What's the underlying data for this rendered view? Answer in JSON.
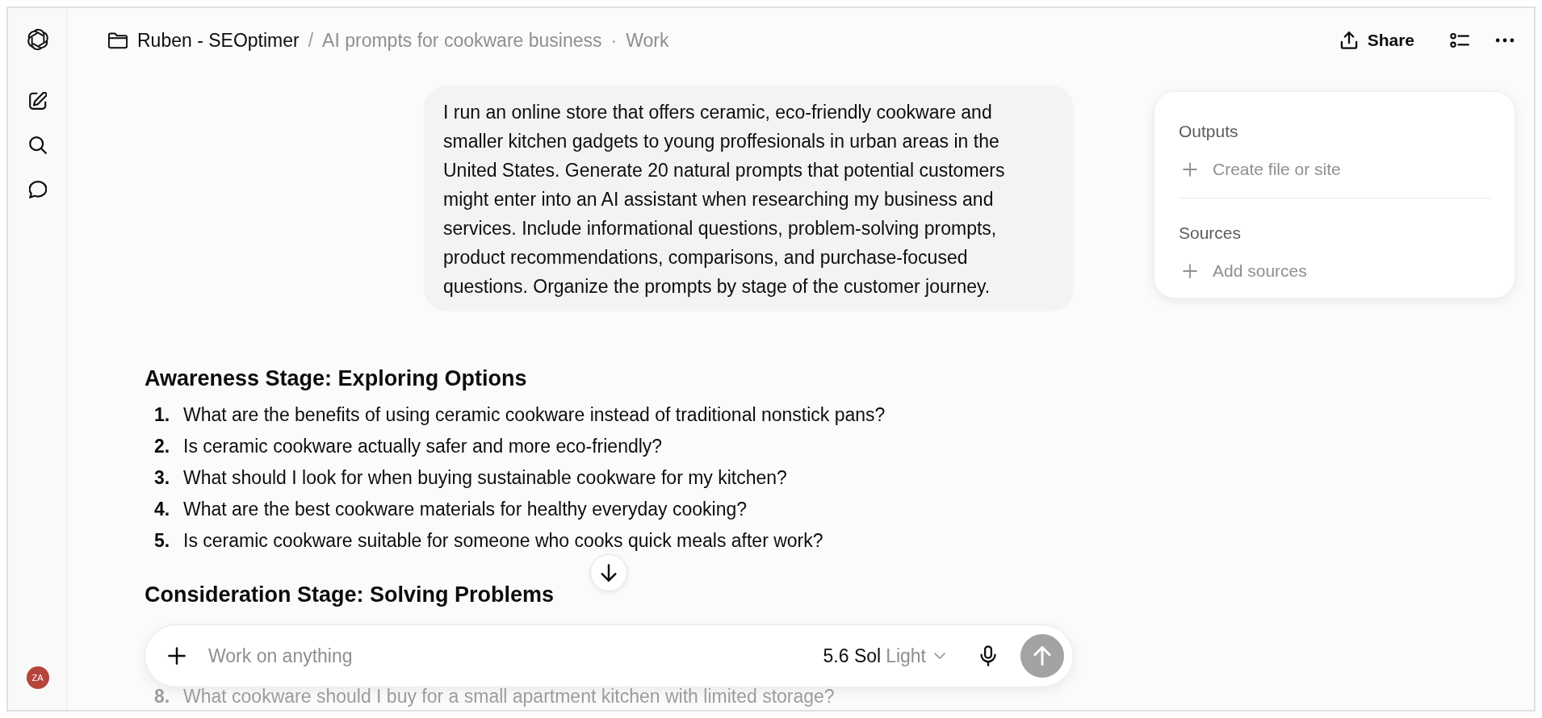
{
  "sidebar": {
    "avatar": {
      "initials": "ZA"
    }
  },
  "breadcrumb": {
    "project": "Ruben - SEOptimer",
    "separator": "/",
    "title": "AI prompts for cookware business",
    "dot": "·",
    "section": "Work"
  },
  "header": {
    "share": "Share"
  },
  "user_message": "I run an online store that offers ceramic, eco-friendly cookware and smaller kitchen gadgets to young proffesionals in urban areas in the United States. Generate 20 natural prompts that potential customers might enter into an AI assistant when researching my business and services. Include informational questions, problem-solving prompts, product recommendations, comparisons, and purchase-focused questions. Organize the prompts by stage of the customer journey.",
  "response": {
    "sections": [
      {
        "heading": "Awareness Stage: Exploring Options",
        "items": [
          {
            "number": "1.",
            "text": "What are the benefits of using ceramic cookware instead of traditional nonstick pans?",
            "faded": false
          },
          {
            "number": "2.",
            "text": "Is ceramic cookware actually safer and more eco-friendly?",
            "faded": false
          },
          {
            "number": "3.",
            "text": "What should I look for when buying sustainable cookware for my kitchen?",
            "faded": false
          },
          {
            "number": "4.",
            "text": "What are the best cookware materials for healthy everyday cooking?",
            "faded": false
          },
          {
            "number": "5.",
            "text": "Is ceramic cookware suitable for someone who cooks quick meals after work?",
            "faded": false
          }
        ]
      },
      {
        "heading": "Consideration Stage: Solving Problems",
        "items": [
          {
            "number": "8.",
            "text": "What cookware should I buy for a small apartment kitchen with limited storage?",
            "faded": true
          }
        ]
      }
    ]
  },
  "composer": {
    "placeholder": "Work on anything",
    "model": "5.6 Sol",
    "mode": "Light"
  },
  "side_panel": {
    "sections": [
      {
        "title": "Outputs",
        "action": "Create file or site"
      },
      {
        "title": "Sources",
        "action": "Add sources"
      }
    ]
  }
}
